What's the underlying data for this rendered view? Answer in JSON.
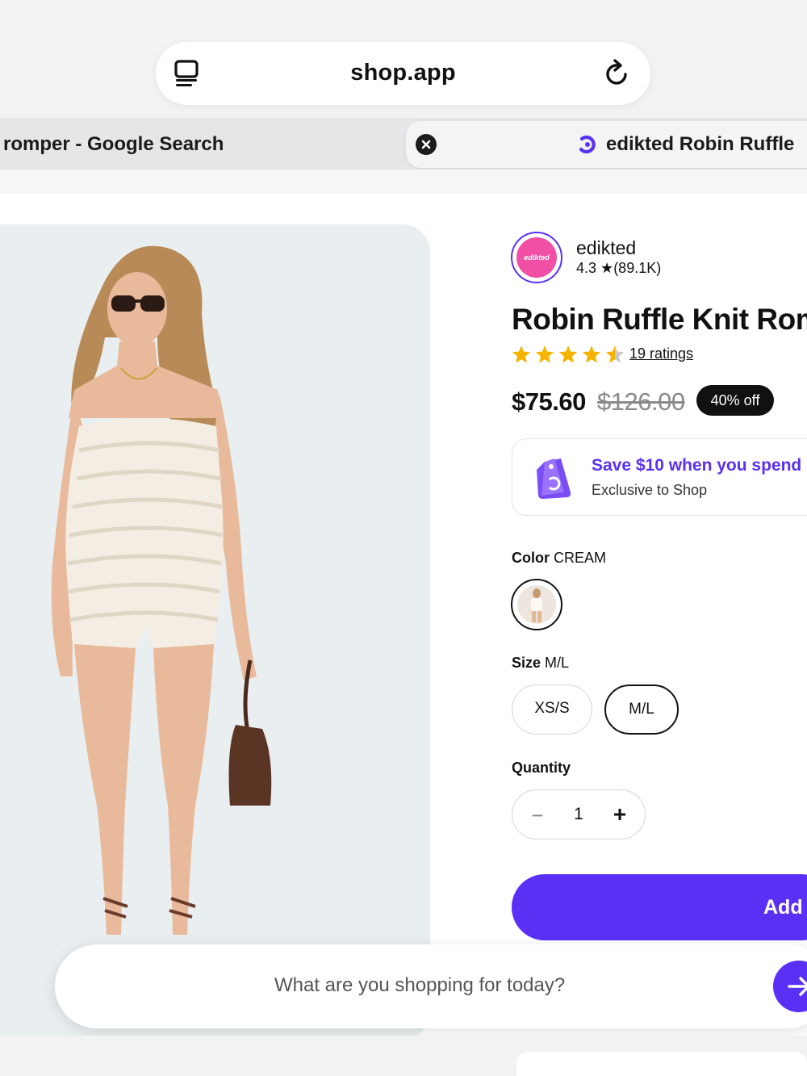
{
  "browser": {
    "url": "shop.app",
    "tabs": [
      {
        "label": "romper - Google Search",
        "active": false
      },
      {
        "label": "edikted Robin Ruffle",
        "active": true
      }
    ]
  },
  "store": {
    "name": "edikted",
    "logo_text": "edikted",
    "rating_value": "4.3",
    "rating_count": "(89.1K)"
  },
  "product": {
    "title": "Robin Ruffle Knit Rom",
    "stars": 4.5,
    "ratings_label": "19 ratings",
    "price": "$75.60",
    "compare_price": "$126.00",
    "discount": "40% off"
  },
  "offer": {
    "title": "Save $10 when you spend",
    "subtitle": "Exclusive to Shop"
  },
  "options": {
    "color_label": "Color",
    "color_value": "CREAM",
    "size_label": "Size",
    "size_value": "M/L",
    "sizes": [
      "XS/S",
      "M/L"
    ],
    "quantity_label": "Quantity",
    "quantity_value": "1"
  },
  "actions": {
    "add_label": "Add"
  },
  "search": {
    "placeholder": "What are you shopping for today?"
  },
  "colors": {
    "accent": "#5a31f4",
    "brand_pink": "#f04fa5",
    "star": "#f5b400"
  }
}
